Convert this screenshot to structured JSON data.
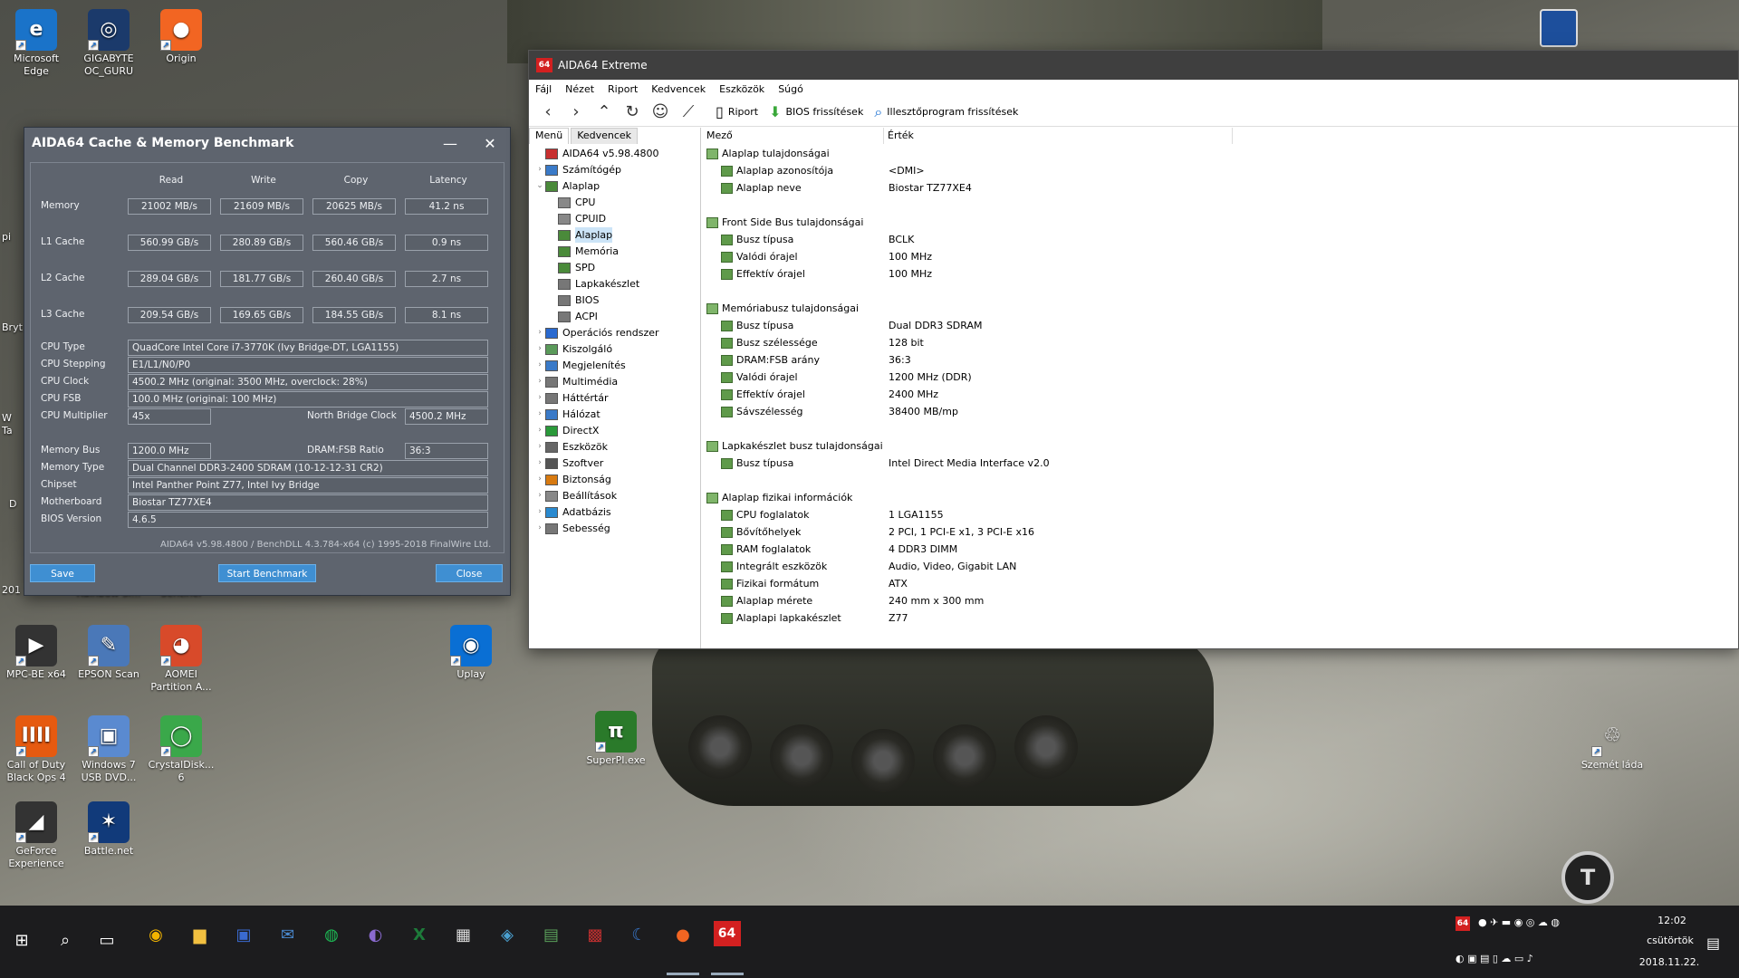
{
  "desktop": {
    "icons": [
      {
        "label": "Microsoft\nEdge",
        "glyph": "e",
        "color": "#1a73c9"
      },
      {
        "label": "GIGABYTE\nOC_GURU",
        "glyph": "◎",
        "color": "#1b3a6b"
      },
      {
        "label": "Origin",
        "glyph": "●",
        "color": "#f26522"
      },
      {
        "label": "Rainbow Si...",
        "glyph": "",
        "color": "transparent"
      },
      {
        "label": "Sentinel",
        "glyph": "",
        "color": "transparent"
      },
      {
        "label": "MPC-BE x64",
        "glyph": "▶",
        "color": "#333"
      },
      {
        "label": "EPSON Scan",
        "glyph": "✎",
        "color": "#4a78b8"
      },
      {
        "label": "AOMEI\nPartition A...",
        "glyph": "◕",
        "color": "#d84a2a"
      },
      {
        "label": "Uplay",
        "glyph": "◉",
        "color": "#0a6fd4"
      },
      {
        "label": "Call of Duty\nBlack Ops 4",
        "glyph": "IIII",
        "color": "#e65a10"
      },
      {
        "label": "Windows 7\nUSB DVD...",
        "glyph": "▣",
        "color": "#5a8ad0"
      },
      {
        "label": "CrystalDisk...\n6",
        "glyph": "◯",
        "color": "#3aa84a"
      },
      {
        "label": "SuperPI.exe",
        "glyph": "π",
        "color": "#2a7a2a"
      },
      {
        "label": "Szemét láda",
        "glyph": "♲",
        "color": "transparent"
      },
      {
        "label": "GeForce\nExperience",
        "glyph": "◢",
        "color": "#333"
      },
      {
        "label": "Battle.net",
        "glyph": "✶",
        "color": "#113a7a"
      }
    ],
    "partial_labels": [
      "pi",
      "Bryt",
      "W\nTa",
      "D",
      "201"
    ]
  },
  "bench": {
    "title": "AIDA64 Cache & Memory Benchmark",
    "minimize": "—",
    "close_x": "✕",
    "cols": [
      "Read",
      "Write",
      "Copy",
      "Latency"
    ],
    "rows": [
      {
        "label": "Memory",
        "values": [
          "21002 MB/s",
          "21609 MB/s",
          "20625 MB/s",
          "41.2 ns"
        ]
      },
      {
        "label": "L1 Cache",
        "values": [
          "560.99 GB/s",
          "280.89 GB/s",
          "560.46 GB/s",
          "0.9 ns"
        ]
      },
      {
        "label": "L2 Cache",
        "values": [
          "289.04 GB/s",
          "181.77 GB/s",
          "260.40 GB/s",
          "2.7 ns"
        ]
      },
      {
        "label": "L3 Cache",
        "values": [
          "209.54 GB/s",
          "169.65 GB/s",
          "184.55 GB/s",
          "8.1 ns"
        ]
      }
    ],
    "cpu_type_label": "CPU Type",
    "cpu_type": "QuadCore Intel Core i7-3770K  (Ivy Bridge-DT, LGA1155)",
    "cpu_stepping_label": "CPU Stepping",
    "cpu_stepping": "E1/L1/N0/P0",
    "cpu_clock_label": "CPU Clock",
    "cpu_clock": "4500.2 MHz  (original: 3500 MHz, overclock: 28%)",
    "cpu_fsb_label": "CPU FSB",
    "cpu_fsb": "100.0 MHz  (original: 100 MHz)",
    "cpu_mult_label": "CPU Multiplier",
    "cpu_mult": "45x",
    "nb_clock_label": "North Bridge Clock",
    "nb_clock": "4500.2 MHz",
    "mem_bus_label": "Memory Bus",
    "mem_bus": "1200.0 MHz",
    "dram_ratio_label": "DRAM:FSB Ratio",
    "dram_ratio": "36:3",
    "mem_type_label": "Memory Type",
    "mem_type": "Dual Channel DDR3-2400 SDRAM  (10-12-12-31 CR2)",
    "chipset_label": "Chipset",
    "chipset": "Intel Panther Point Z77, Intel Ivy Bridge",
    "mobo_label": "Motherboard",
    "mobo": "Biostar TZ77XE4",
    "bios_label": "BIOS Version",
    "bios": "4.6.5",
    "footer": "AIDA64 v5.98.4800 / BenchDLL 4.3.784-x64  (c) 1995-2018 FinalWire Ltd.",
    "save": "Save",
    "start": "Start Benchmark",
    "close": "Close"
  },
  "aida": {
    "title": "AIDA64 Extreme",
    "logo": "64",
    "menu": [
      "Fájl",
      "Nézet",
      "Riport",
      "Kedvencek",
      "Eszközök",
      "Súgó"
    ],
    "toolbar": {
      "report": "Riport",
      "bios": "BIOS frissítések",
      "driver": "Illesztőprogram frissítések"
    },
    "tabs": [
      "Menü",
      "Kedvencek"
    ],
    "tree": [
      {
        "t": "AIDA64 v5.98.4800",
        "lvl": 0,
        "ex": ""
      },
      {
        "t": "Számítógép",
        "lvl": 1,
        "ex": "›"
      },
      {
        "t": "Alaplap",
        "lvl": 1,
        "ex": "⌄"
      },
      {
        "t": "CPU",
        "lvl": 2,
        "ex": ""
      },
      {
        "t": "CPUID",
        "lvl": 2,
        "ex": ""
      },
      {
        "t": "Alaplap",
        "lvl": 2,
        "ex": "",
        "sel": true
      },
      {
        "t": "Memória",
        "lvl": 2,
        "ex": ""
      },
      {
        "t": "SPD",
        "lvl": 2,
        "ex": ""
      },
      {
        "t": "Lapkakészlet",
        "lvl": 2,
        "ex": ""
      },
      {
        "t": "BIOS",
        "lvl": 2,
        "ex": ""
      },
      {
        "t": "ACPI",
        "lvl": 2,
        "ex": ""
      },
      {
        "t": "Operációs rendszer",
        "lvl": 1,
        "ex": "›"
      },
      {
        "t": "Kiszolgáló",
        "lvl": 1,
        "ex": "›"
      },
      {
        "t": "Megjelenítés",
        "lvl": 1,
        "ex": "›"
      },
      {
        "t": "Multimédia",
        "lvl": 1,
        "ex": "›"
      },
      {
        "t": "Háttértár",
        "lvl": 1,
        "ex": "›"
      },
      {
        "t": "Hálózat",
        "lvl": 1,
        "ex": "›"
      },
      {
        "t": "DirectX",
        "lvl": 1,
        "ex": "›"
      },
      {
        "t": "Eszközök",
        "lvl": 1,
        "ex": "›"
      },
      {
        "t": "Szoftver",
        "lvl": 1,
        "ex": "›"
      },
      {
        "t": "Biztonság",
        "lvl": 1,
        "ex": "›"
      },
      {
        "t": "Beállítások",
        "lvl": 1,
        "ex": "›"
      },
      {
        "t": "Adatbázis",
        "lvl": 1,
        "ex": "›"
      },
      {
        "t": "Sebesség",
        "lvl": 1,
        "ex": "›"
      }
    ],
    "col_field": "Mező",
    "col_value": "Érték",
    "groups": [
      {
        "title": "Alaplap tulajdonságai",
        "rows": [
          [
            "Alaplap azonosítója",
            "<DMI>"
          ],
          [
            "Alaplap neve",
            "Biostar TZ77XE4"
          ]
        ]
      },
      {
        "title": "Front Side Bus tulajdonságai",
        "rows": [
          [
            "Busz típusa",
            "BCLK"
          ],
          [
            "Valódi órajel",
            "100 MHz"
          ],
          [
            "Effektív órajel",
            "100 MHz"
          ]
        ]
      },
      {
        "title": "Memóriabusz tulajdonságai",
        "rows": [
          [
            "Busz típusa",
            "Dual DDR3 SDRAM"
          ],
          [
            "Busz szélessége",
            "128 bit"
          ],
          [
            "DRAM:FSB arány",
            "36:3"
          ],
          [
            "Valódi órajel",
            "1200 MHz (DDR)"
          ],
          [
            "Effektív órajel",
            "2400 MHz"
          ],
          [
            "Sávszélesség",
            "38400 MB/mp"
          ]
        ]
      },
      {
        "title": "Lapkakészlet busz tulajdonságai",
        "rows": [
          [
            "Busz típusa",
            "Intel Direct Media Interface v2.0"
          ]
        ]
      },
      {
        "title": "Alaplap fizikai információk",
        "rows": [
          [
            "CPU foglalatok",
            "1 LGA1155"
          ],
          [
            "Bővítőhelyek",
            "2 PCI, 1 PCI-E x1, 3 PCI-E x16"
          ],
          [
            "RAM foglalatok",
            "4 DDR3 DIMM"
          ],
          [
            "Integrált eszközök",
            "Audio, Video, Gigabit LAN"
          ],
          [
            "Fizikai formátum",
            "ATX"
          ],
          [
            "Alaplap mérete",
            "240 mm x 300 mm"
          ],
          [
            "Alaplapi lapkakészlet",
            "Z77"
          ]
        ]
      }
    ]
  },
  "taskbar": {
    "apps": [
      "chrome-icon",
      "folder-icon",
      "floppy-icon",
      "thunderbird-icon",
      "spotify-icon",
      "eclipse-icon",
      "excel-icon",
      "calculator-icon",
      "vpn-icon",
      "photos-icon",
      "cpuz-icon",
      "crescent-icon",
      "origin-icon",
      "aida64-icon"
    ],
    "aida_tray": "64",
    "time": "12:02",
    "day": "csütörtök",
    "date": "2018.11.22."
  }
}
